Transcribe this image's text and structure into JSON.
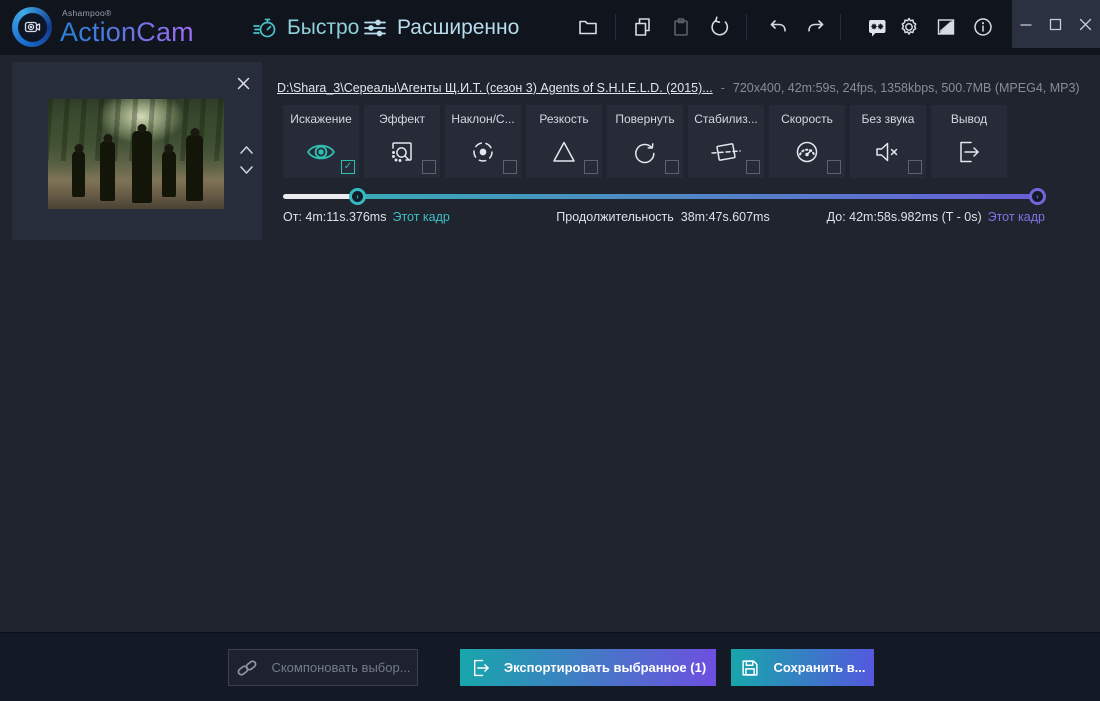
{
  "colors": {
    "accent_teal": "#2fbfb2",
    "accent_purple": "#7366dd",
    "link_teal": "#3fbdc5",
    "link_purple": "#8172e6",
    "export_gradient_start": "#18a6ab",
    "export_gradient_end": "#6e4fe0"
  },
  "topbar": {
    "brand_small": "Ashampoo®",
    "brand": "ActionCam",
    "tab_fast": "Быстро",
    "tab_advanced": "Расширенно"
  },
  "file": {
    "path": "D:\\Shara_3\\Сереалы\\Агенты Щ.И.Т. (сезон 3) Agents of S.H.I.E.L.D. (2015)...",
    "dash": "-",
    "info": "720x400, 42m:59s, 24fps, 1358kbps, 500.7MB (MPEG4, MP3)"
  },
  "tools": {
    "items": [
      {
        "label": "Искажение",
        "checked": true,
        "checkbox": true
      },
      {
        "label": "Эффект",
        "checked": false,
        "checkbox": true
      },
      {
        "label": "Наклон/С...",
        "checked": false,
        "checkbox": true
      },
      {
        "label": "Резкость",
        "checked": false,
        "checkbox": true
      },
      {
        "label": "Повернуть",
        "checked": false,
        "checkbox": true
      },
      {
        "label": "Стабилиз...",
        "checked": false,
        "checkbox": true
      },
      {
        "label": "Скорость",
        "checked": false,
        "checkbox": true
      },
      {
        "label": "Без звука",
        "checked": false,
        "checkbox": true
      },
      {
        "label": "Вывод",
        "checked": false,
        "checkbox": false
      }
    ]
  },
  "timeline": {
    "from_label": "От:",
    "from_value": "4m:11s.376ms",
    "frame_link_left": "Этот кадр",
    "duration_label": "Продолжительность",
    "duration_value": "38m:47s.607ms",
    "to_label": "До:",
    "to_value": "42m:58s.982ms (T - 0s)",
    "frame_link_right": "Этот кадр"
  },
  "footer": {
    "compose": "Скомпоновать выбор...",
    "export": "Экспортировать выбранное (1)",
    "save": "Сохранить в..."
  }
}
